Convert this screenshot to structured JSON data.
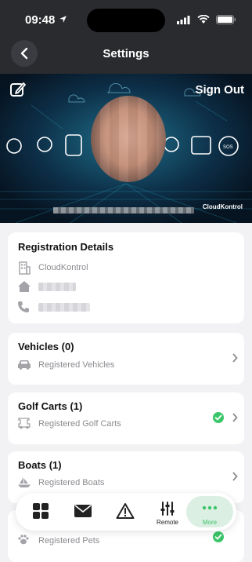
{
  "status_bar": {
    "time": "09:48"
  },
  "nav": {
    "title": "Settings"
  },
  "hero": {
    "sign_out_label": "Sign Out",
    "brand": "CloudKontrol"
  },
  "registration": {
    "title": "Registration Details",
    "company": "CloudKontrol"
  },
  "vehicles": {
    "title": "Vehicles (0)",
    "subtitle": "Registered Vehicles"
  },
  "golf_carts": {
    "title": "Golf Carts (1)",
    "subtitle": "Registered Golf Carts"
  },
  "boats": {
    "title": "Boats (1)",
    "subtitle": "Registered Boats"
  },
  "pets": {
    "subtitle": "Registered Pets"
  },
  "tab_bar": {
    "remote_label": "Remote",
    "more_label": "More"
  },
  "colors": {
    "accent_green": "#3ac569",
    "header_dark": "#2a2b2f",
    "muted_text": "#8b8b90"
  }
}
